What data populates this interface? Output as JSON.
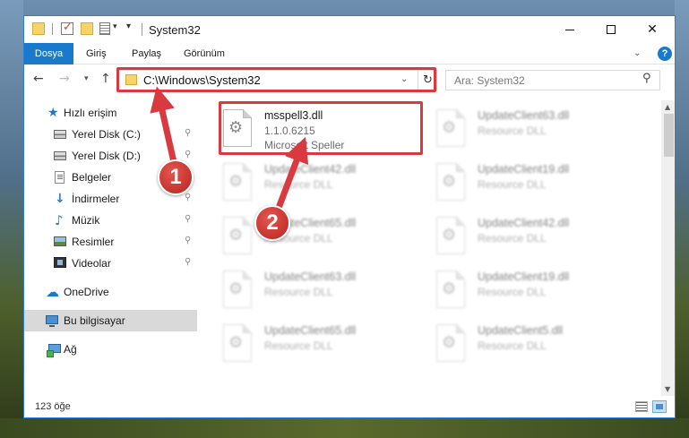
{
  "window": {
    "title": "System32",
    "minimize_glyph": "",
    "maximize_glyph": "",
    "close_glyph": "✕"
  },
  "ribbon": {
    "file_tab": "Dosya",
    "tabs": [
      "Giriş",
      "Paylaş",
      "Görünüm"
    ],
    "help_glyph": "?"
  },
  "nav": {
    "back_glyph": "←",
    "forward_glyph": "→",
    "recent_glyph": "▾",
    "up_glyph": "↑",
    "address": "C:\\Windows\\System32",
    "refresh_glyph": "↻",
    "dropdown_glyph": "⌄",
    "search_placeholder": "Ara: System32",
    "search_glyph": "⚲"
  },
  "sidebar": {
    "quick_access": "Hızlı erişim",
    "items": [
      {
        "label": "Yerel Disk (C:)",
        "icon": "disk-icon",
        "pinned": true
      },
      {
        "label": "Yerel Disk (D:)",
        "icon": "disk-icon",
        "pinned": true
      },
      {
        "label": "Belgeler",
        "icon": "documents-icon",
        "pinned": true
      },
      {
        "label": "İndirmeler",
        "icon": "downloads-icon",
        "pinned": true
      },
      {
        "label": "Müzik",
        "icon": "music-icon",
        "pinned": true
      },
      {
        "label": "Resimler",
        "icon": "pictures-icon",
        "pinned": true
      },
      {
        "label": "Videolar",
        "icon": "videos-icon",
        "pinned": true
      }
    ],
    "onedrive": "OneDrive",
    "this_pc": "Bu bilgisayar",
    "network": "Ağ",
    "pin_glyph": "📌"
  },
  "files": {
    "main": {
      "name": "msspell3.dll",
      "version": "1.1.0.6215",
      "description": "Microsoft Speller"
    },
    "blurred": [
      {
        "name": "UpdateClient63.dll",
        "type": "Resource DLL"
      },
      {
        "name": "UpdateClient42.dll",
        "type": "Resource DLL"
      },
      {
        "name": "UpdateClient19.dll",
        "type": "Resource DLL"
      },
      {
        "name": "UpdateClient65.dll",
        "type": "Resource DLL"
      },
      {
        "name": "UpdateClient42.dll",
        "type": "Resource DLL"
      },
      {
        "name": "UpdateClient63.dll",
        "type": "Resource DLL"
      },
      {
        "name": "UpdateClient19.dll",
        "type": "Resource DLL"
      },
      {
        "name": "UpdateClient65.dll",
        "type": "Resource DLL"
      },
      {
        "name": "UpdateClient5.dll",
        "type": "Resource DLL"
      }
    ]
  },
  "status": {
    "count": "123 öğe"
  },
  "annotations": {
    "step1": "1",
    "step2": "2",
    "color": "#d83a3f"
  }
}
